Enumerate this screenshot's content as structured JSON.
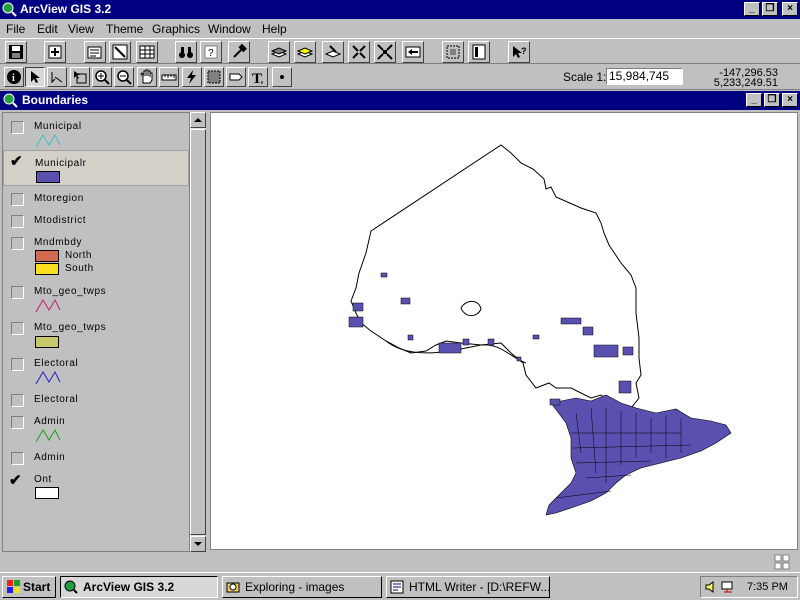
{
  "app": {
    "title": "ArcView GIS 3.2"
  },
  "menu": [
    {
      "label": "File",
      "u": "F"
    },
    {
      "label": "Edit",
      "u": "E"
    },
    {
      "label": "View",
      "u": "V"
    },
    {
      "label": "Theme",
      "u": "T"
    },
    {
      "label": "Graphics",
      "u": "G"
    },
    {
      "label": "Window",
      "u": "W"
    },
    {
      "label": "Help",
      "u": "H"
    }
  ],
  "scale": {
    "label": "Scale 1:",
    "value": "15,984,745"
  },
  "coords": {
    "x": "-147,296.53",
    "y": "5,233,249.51"
  },
  "view": {
    "title": "Boundaries"
  },
  "themes": [
    {
      "name": "Municipal",
      "checked": false,
      "legend": "line",
      "color": "#40c0c0"
    },
    {
      "name": "Municipalr",
      "checked": true,
      "legend": "fill",
      "color": "#5a50b0"
    },
    {
      "name": "Mtoregion",
      "checked": false
    },
    {
      "name": "Mtodistrict",
      "checked": false
    },
    {
      "name": "Mndmbdy",
      "checked": false,
      "classes": [
        {
          "label": "North",
          "color": "#d06a50"
        },
        {
          "label": "South",
          "color": "#f8e020"
        }
      ]
    },
    {
      "name": "Mto_geo_twps",
      "checked": false,
      "legend": "line",
      "color": "#c0207a"
    },
    {
      "name": "Mto_geo_twps",
      "checked": false,
      "legend": "fill",
      "color": "#c8c86a"
    },
    {
      "name": "Electoral",
      "checked": false,
      "legend": "line",
      "color": "#2020d0"
    },
    {
      "name": "Electoral",
      "checked": false
    },
    {
      "name": "Admin",
      "checked": false,
      "legend": "line",
      "color": "#20a020"
    },
    {
      "name": "Admin",
      "checked": false
    },
    {
      "name": "Ont",
      "checked": true,
      "legend": "fill",
      "color": "#ffffff"
    }
  ],
  "taskbar": {
    "start": "Start",
    "tasks": [
      {
        "label": "ArcView GIS 3.2",
        "active": true
      },
      {
        "label": "Exploring - images",
        "active": false
      },
      {
        "label": "HTML Writer - [D:\\REFW...",
        "active": false
      }
    ],
    "clock": "7:35 PM"
  }
}
